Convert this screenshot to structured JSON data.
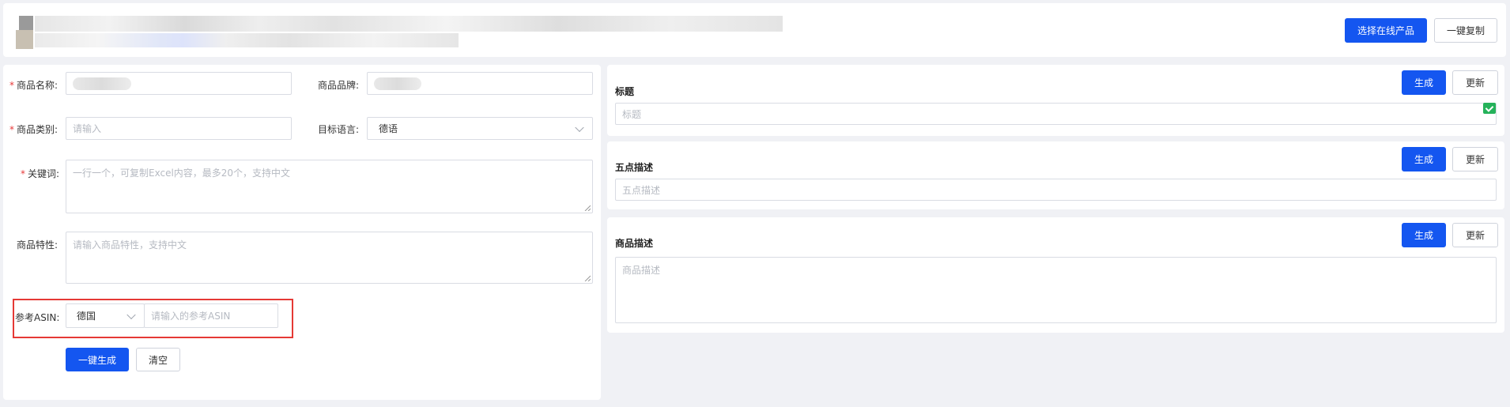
{
  "topbar": {
    "select_product_label": "选择在线产品",
    "copy_all_label": "一键复制"
  },
  "form": {
    "product_name_label": "商品名称:",
    "product_brand_label": "商品品牌:",
    "category_label": "商品类别:",
    "category_placeholder": "请输入",
    "target_lang_label": "目标语言:",
    "target_lang_value": "德语",
    "keywords_label": "关键词:",
    "keywords_placeholder": "一行一个，可复制Excel内容，最多20个，支持中文",
    "features_label": "商品特性:",
    "features_placeholder": "请输入商品特性，支持中文",
    "asin_label": "参考ASIN:",
    "asin_country": "德国",
    "asin_placeholder": "请输入的参考ASIN",
    "generate_all_label": "一键生成",
    "clear_label": "清空",
    "required_mark": "*"
  },
  "cards": {
    "title": {
      "heading": "标题",
      "placeholder": "标题",
      "generate": "生成",
      "update": "更新"
    },
    "bullets": {
      "heading": "五点描述",
      "placeholder": "五点描述",
      "generate": "生成",
      "update": "更新"
    },
    "description": {
      "heading": "商品描述",
      "placeholder": "商品描述",
      "generate": "生成",
      "update": "更新"
    }
  },
  "colors": {
    "primary": "#1456f0",
    "required": "#e83a3a",
    "highlight": "#e53935",
    "success": "#25b25a"
  }
}
